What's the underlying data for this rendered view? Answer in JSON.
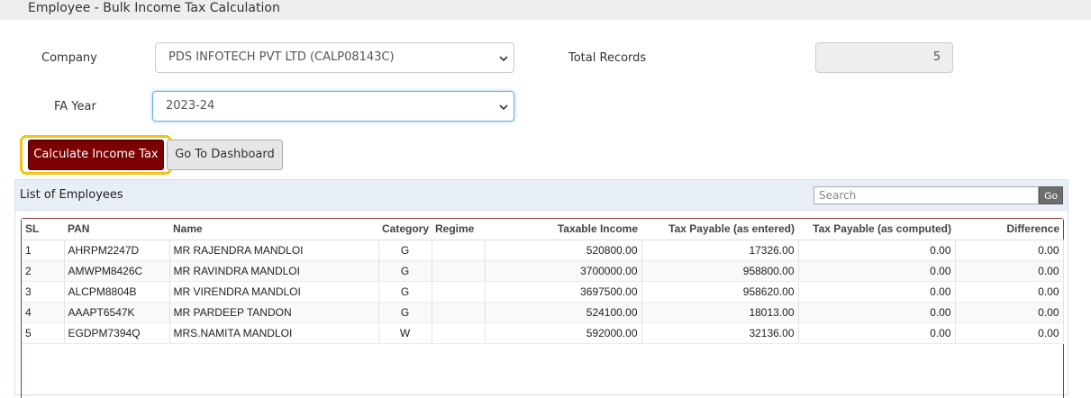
{
  "page": {
    "title": "Employee - Bulk Income Tax Calculation"
  },
  "form": {
    "company_label": "Company",
    "company_value": "PDS INFOTECH PVT LTD (CALP08143C)",
    "total_records_label": "Total Records",
    "total_records_value": "5",
    "fa_year_label": "FA Year",
    "fa_year_value": "2023-24"
  },
  "buttons": {
    "calculate": "Calculate Income Tax",
    "dashboard": "Go To Dashboard"
  },
  "panel": {
    "title": "List of Employees",
    "search_placeholder": "Search",
    "go_label": "Go"
  },
  "table": {
    "headers": [
      "SL",
      "PAN",
      "Name",
      "Category",
      "Regime",
      "Taxable Income",
      "Tax Payable (as entered)",
      "Tax Payable (as computed)",
      "Difference"
    ],
    "rows": [
      [
        "1",
        "AHRPM2247D",
        "MR RAJENDRA MANDLOI",
        "G",
        "",
        "520800.00",
        "17326.00",
        "0.00",
        "0.00"
      ],
      [
        "2",
        "AMWPM8426C",
        "MR RAVINDRA MANDLOI",
        "G",
        "",
        "3700000.00",
        "958800.00",
        "0.00",
        "0.00"
      ],
      [
        "3",
        "ALCPM8804B",
        "MR VIRENDRA MANDLOI",
        "G",
        "",
        "3697500.00",
        "958620.00",
        "0.00",
        "0.00"
      ],
      [
        "4",
        "AAAPT6547K",
        "MR PARDEEP TANDON",
        "G",
        "",
        "524100.00",
        "18013.00",
        "0.00",
        "0.00"
      ],
      [
        "5",
        "EGDPM7394Q",
        "MRS.NAMITA MANDLOI",
        "W",
        "",
        "592000.00",
        "32136.00",
        "0.00",
        "0.00"
      ]
    ]
  },
  "colors": {
    "primary_button": "#7b0000",
    "highlight": "#f3c31a",
    "focus": "#66afe9"
  }
}
